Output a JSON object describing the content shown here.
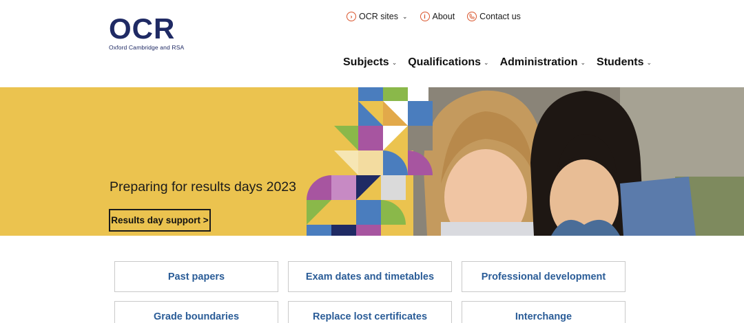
{
  "logo": {
    "mark": "OCR",
    "tagline": "Oxford Cambridge and RSA"
  },
  "utility_nav": [
    {
      "label": "OCR sites",
      "icon": "chevron-right-circle-icon",
      "dropdown": true
    },
    {
      "label": "About",
      "icon": "info-circle-icon",
      "dropdown": false
    },
    {
      "label": "Contact us",
      "icon": "phone-circle-icon",
      "dropdown": false
    }
  ],
  "main_nav": [
    {
      "label": "Subjects"
    },
    {
      "label": "Qualifications"
    },
    {
      "label": "Administration"
    },
    {
      "label": "Students"
    }
  ],
  "hero": {
    "title": "Preparing for results days 2023",
    "button_label": "Results day support >"
  },
  "quick_links": [
    {
      "label": "Past papers"
    },
    {
      "label": "Exam dates and timetables"
    },
    {
      "label": "Professional development"
    },
    {
      "label": "Grade boundaries"
    },
    {
      "label": "Replace lost certificates"
    },
    {
      "label": "Interchange"
    }
  ],
  "colors": {
    "brand_navy": "#1f2a64",
    "accent_orange": "#d9542b",
    "hero_yellow": "#ebc34f",
    "link_blue": "#2a5c97"
  }
}
